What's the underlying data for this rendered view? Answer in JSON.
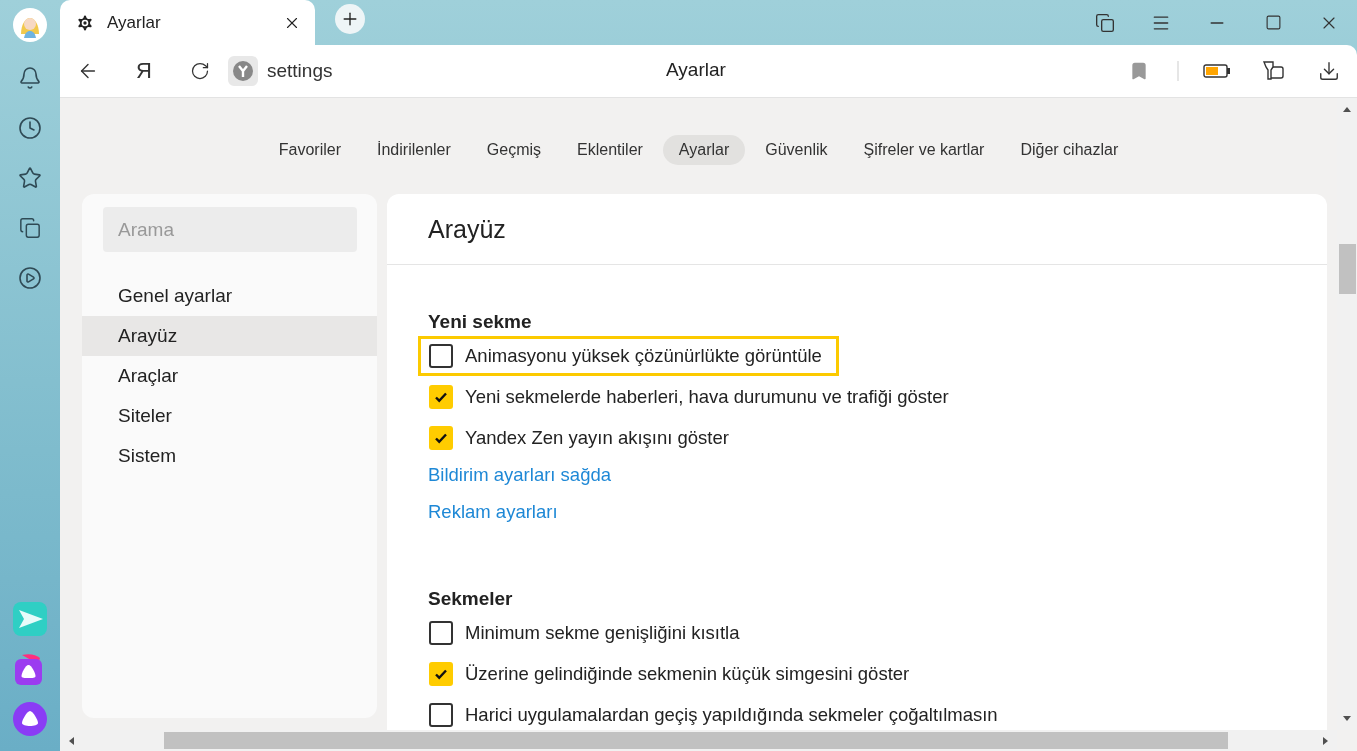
{
  "browser": {
    "tab_title": "Ayarlar",
    "home_glyph": "Я",
    "address": "settings",
    "page_title": "Ayarlar"
  },
  "nav_tabs": [
    {
      "label": "Favoriler",
      "selected": false
    },
    {
      "label": "İndirilenler",
      "selected": false
    },
    {
      "label": "Geçmiş",
      "selected": false
    },
    {
      "label": "Eklentiler",
      "selected": false
    },
    {
      "label": "Ayarlar",
      "selected": true
    },
    {
      "label": "Güvenlik",
      "selected": false
    },
    {
      "label": "Şifreler ve kartlar",
      "selected": false
    },
    {
      "label": "Diğer cihazlar",
      "selected": false
    }
  ],
  "search": {
    "placeholder": "Arama"
  },
  "sidebar": {
    "items": [
      {
        "label": "Genel ayarlar",
        "selected": false
      },
      {
        "label": "Arayüz",
        "selected": true
      },
      {
        "label": "Araçlar",
        "selected": false
      },
      {
        "label": "Siteler",
        "selected": false
      },
      {
        "label": "Sistem",
        "selected": false
      }
    ]
  },
  "section": {
    "title": "Arayüz",
    "groups": [
      {
        "title": "Yeni sekme",
        "items": [
          {
            "kind": "checkbox",
            "label": "Animasyonu yüksek çözünürlükte görüntüle",
            "checked": false,
            "focused": true
          },
          {
            "kind": "checkbox",
            "label": "Yeni sekmelerde haberleri, hava durumunu ve trafiği göster",
            "checked": true,
            "focused": false
          },
          {
            "kind": "checkbox",
            "label": "Yandex Zen yayın akışını göster",
            "checked": true,
            "focused": false
          },
          {
            "kind": "link",
            "label": "Bildirim ayarları sağda"
          },
          {
            "kind": "link",
            "label": "Reklam ayarları"
          }
        ]
      },
      {
        "title": "Sekmeler",
        "items": [
          {
            "kind": "checkbox",
            "label": "Minimum sekme genişliğini kısıtla",
            "checked": false,
            "focused": false
          },
          {
            "kind": "checkbox",
            "label": "Üzerine gelindiğinde sekmenin küçük simgesini göster",
            "checked": true,
            "focused": false
          },
          {
            "kind": "checkbox",
            "label": "Harici uygulamalardan geçiş yapıldığında sekmeler çoğaltılmasın",
            "checked": false,
            "focused": false
          }
        ]
      }
    ]
  }
}
